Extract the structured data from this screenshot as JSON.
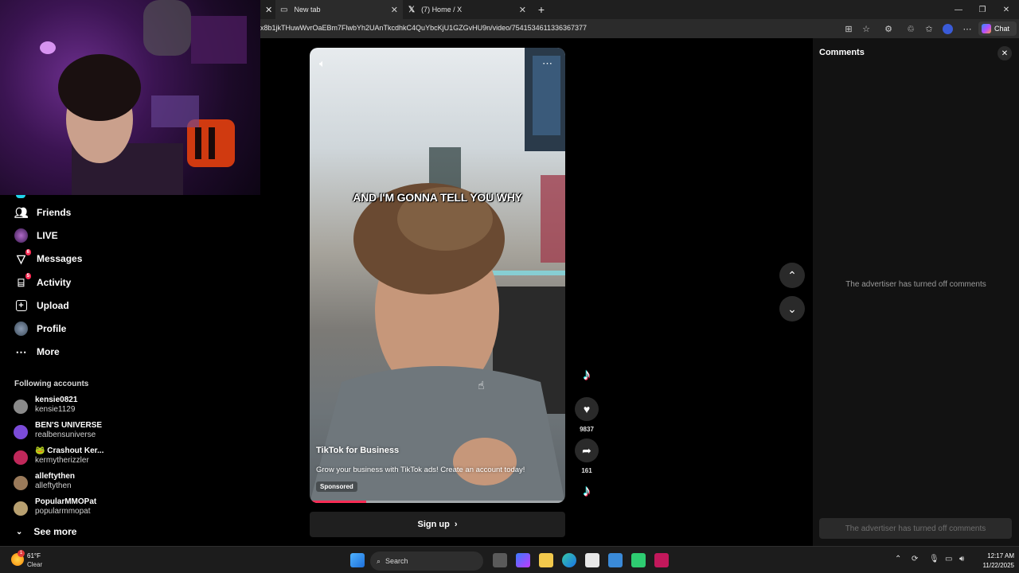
{
  "browser": {
    "tabs": [
      {
        "label": "New tab"
      },
      {
        "label": "(7) Home / X"
      }
    ],
    "url_fragment": "x8b1jkTHuwWvrOaEBm7FlwbYh2UAnTkcdhkC4QuYbcKjU1GZGvHU9n/video/7541534611336367377",
    "chat_label": "Chat"
  },
  "sidebar": {
    "items": [
      {
        "label": "Friends",
        "icon": "friends-icon"
      },
      {
        "label": "LIVE",
        "icon": "live-avatar-icon"
      },
      {
        "label": "Messages",
        "icon": "messages-icon",
        "badge": "6"
      },
      {
        "label": "Activity",
        "icon": "activity-icon",
        "badge": "5"
      },
      {
        "label": "Upload",
        "icon": "upload-icon"
      },
      {
        "label": "Profile",
        "icon": "profile-avatar-icon"
      },
      {
        "label": "More",
        "icon": "more-icon"
      }
    ],
    "following_title": "Following accounts",
    "accounts": [
      {
        "name": "kensie0821",
        "handle": "kensie1129",
        "color": "#8a8a8a"
      },
      {
        "name": "BEN'S UNIVERSE",
        "handle": "realbensuniverse",
        "color": "#7b4bd8"
      },
      {
        "name": "🐸 Crashout Ker...",
        "handle": "kermytherizzler",
        "color": "#c0285a"
      },
      {
        "name": "alleftythen",
        "handle": "alleftythen",
        "color": "#9a7a5a"
      },
      {
        "name": "PopularMMOPat",
        "handle": "popularmmopat",
        "color": "#b8a070"
      }
    ],
    "see_more": "See more"
  },
  "video": {
    "caption": "AND I'M GONNA TELL YOU WHY",
    "title": "TikTok for Business",
    "description": "Grow your business with TikTok ads! Create an account today!",
    "sponsored": "Sponsored",
    "progress": 0.22,
    "signup_label": "Sign up"
  },
  "actions": {
    "likes": "9837",
    "shares": "161"
  },
  "comments": {
    "title": "Comments",
    "empty_message": "The advertiser has turned off comments",
    "input_placeholder": "The advertiser has turned off comments"
  },
  "taskbar": {
    "temperature": "61°F",
    "condition": "Clear",
    "weather_badge": "1",
    "search_label": "Search",
    "time": "12:17 AM",
    "date": "11/22/2025"
  },
  "colors": {
    "accent": "#fe2c55",
    "tiktok_cyan": "#25f4ee"
  }
}
